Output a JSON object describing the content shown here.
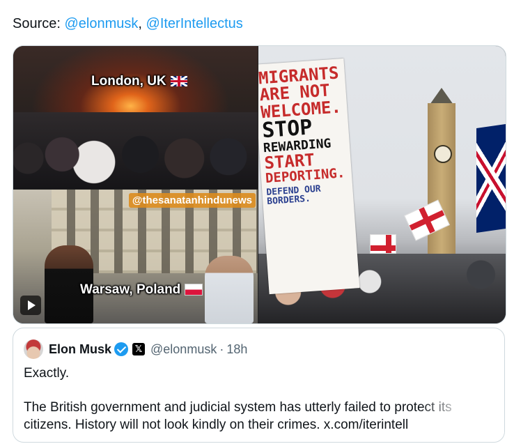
{
  "source": {
    "prefix": "Source: ",
    "handle1": "@elonmusk",
    "separator": ", ",
    "handle2": "@IterIntellectus"
  },
  "media": {
    "tile_london_caption": "London, UK",
    "tile_warsaw_caption": "Warsaw, Poland",
    "watermark": "@thesanatanhindunews",
    "sign_lines": {
      "line1": "MIGRANTS",
      "line2": "ARE NOT",
      "line3": "WELCOME.",
      "line4": "STOP",
      "line5": "REWARDING",
      "line6": "START",
      "line7": "DEPORTING.",
      "line8": "DEFEND OUR BORDERS."
    }
  },
  "quoted_post": {
    "name": "Elon Musk",
    "handle": "@elonmusk",
    "dot": "·",
    "time": "18h",
    "paragraph1": "Exactly.",
    "paragraph2": "The British government and judicial system has utterly failed to protect its citizens. History will not look kindly on their crimes. x.com/iterintell",
    "x_badge": "𝕏"
  },
  "colors": {
    "link": "#1d9bf0",
    "verified": "#1d9bf0",
    "secondary_text": "#536471"
  },
  "icons": {
    "verified": "verified-badge-icon",
    "x_logo": "x-logo-icon",
    "play": "play-icon"
  }
}
